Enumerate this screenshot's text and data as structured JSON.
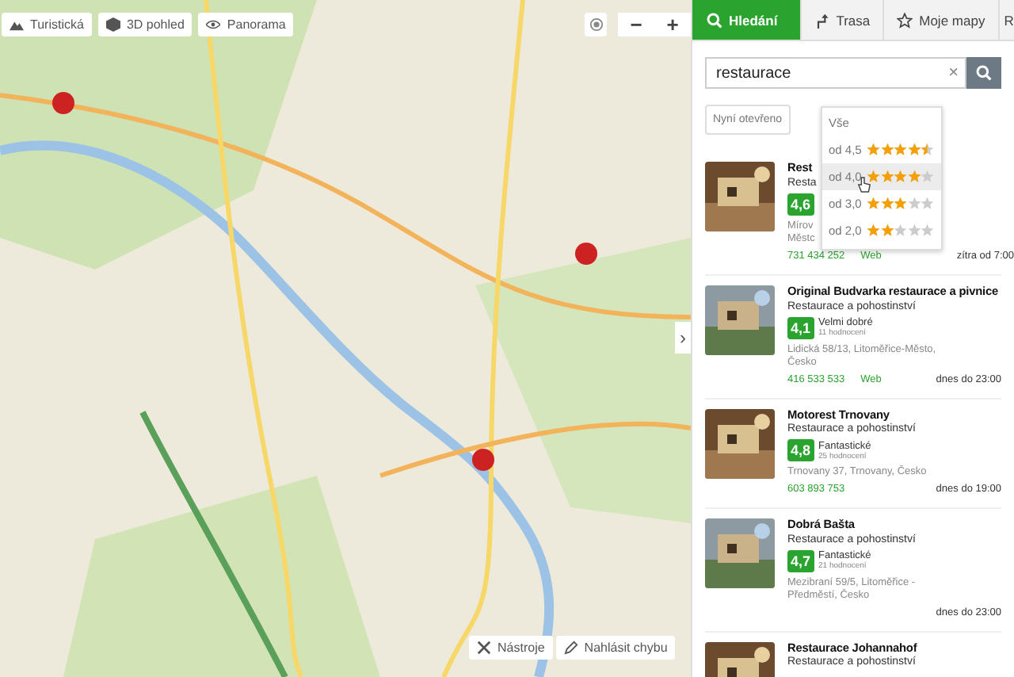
{
  "map": {
    "kind": "picture",
    "toolbar": [
      {
        "label": "Turistická"
      },
      {
        "label": "3D pohled"
      },
      {
        "label": "Panorama"
      }
    ],
    "zoom": {
      "out": "−",
      "in": "+"
    },
    "tools": [
      {
        "label": "Nástroje"
      },
      {
        "label": "Nahlásit chybu"
      }
    ],
    "collapse": "›"
  },
  "tabs": [
    {
      "label": "Hledání",
      "selected": true
    },
    {
      "label": "Trasa",
      "selected": false
    },
    {
      "label": "Moje mapy",
      "selected": false
    },
    {
      "label": "R",
      "selected": false
    }
  ],
  "search": {
    "value": "restaurace",
    "clear": "×"
  },
  "filter": {
    "label": "Nyní otevřeno"
  },
  "rating_menu": {
    "title": "Vše",
    "options": [
      {
        "label": "od 4,5",
        "stars": 4.5,
        "highlighted": false
      },
      {
        "label": "od 4,0",
        "stars": 4,
        "highlighted": true
      },
      {
        "label": "od 3,0",
        "stars": 3,
        "highlighted": false
      },
      {
        "label": "od 2,0",
        "stars": 2,
        "highlighted": false
      }
    ]
  },
  "results": [
    {
      "name": "Rest",
      "category": "Resta",
      "score": "4,6",
      "address": [
        "Mírov",
        "Městc"
      ],
      "phone": "731 434 252",
      "web": "Web",
      "hours": "zítra od 7:00"
    },
    {
      "name": "Original Budvarka restaurace a pivnice",
      "category": "Restaurace a pohostinství",
      "score": "4,1",
      "verdict": "Velmi dobré",
      "count": "11 hodnocení",
      "address": [
        "Lidická 58/13, Litoměřice-Město,",
        "Česko"
      ],
      "phone": "416 533 533",
      "web": "Web",
      "hours": "dnes do 23:00"
    },
    {
      "name": "Motorest Trnovany",
      "category": "Restaurace a pohostinství",
      "score": "4,8",
      "verdict": "Fantastické",
      "count": "25 hodnocení",
      "address": [
        "Trnovany 37, Trnovany, Česko"
      ],
      "phone": "603 893 753",
      "hours": "dnes do 19:00"
    },
    {
      "name": "Dobrá Bašta",
      "category": "Restaurace a pohostinství",
      "score": "4,7",
      "verdict": "Fantastické",
      "count": "21 hodnocení",
      "address": [
        "Mezibraní 59/5, Litoměřice -",
        "Předměstí, Česko"
      ],
      "hours": "dnes do 23:00"
    },
    {
      "name": "Restaurace Johannahof",
      "category": "Restaurace a pohostinství"
    }
  ]
}
